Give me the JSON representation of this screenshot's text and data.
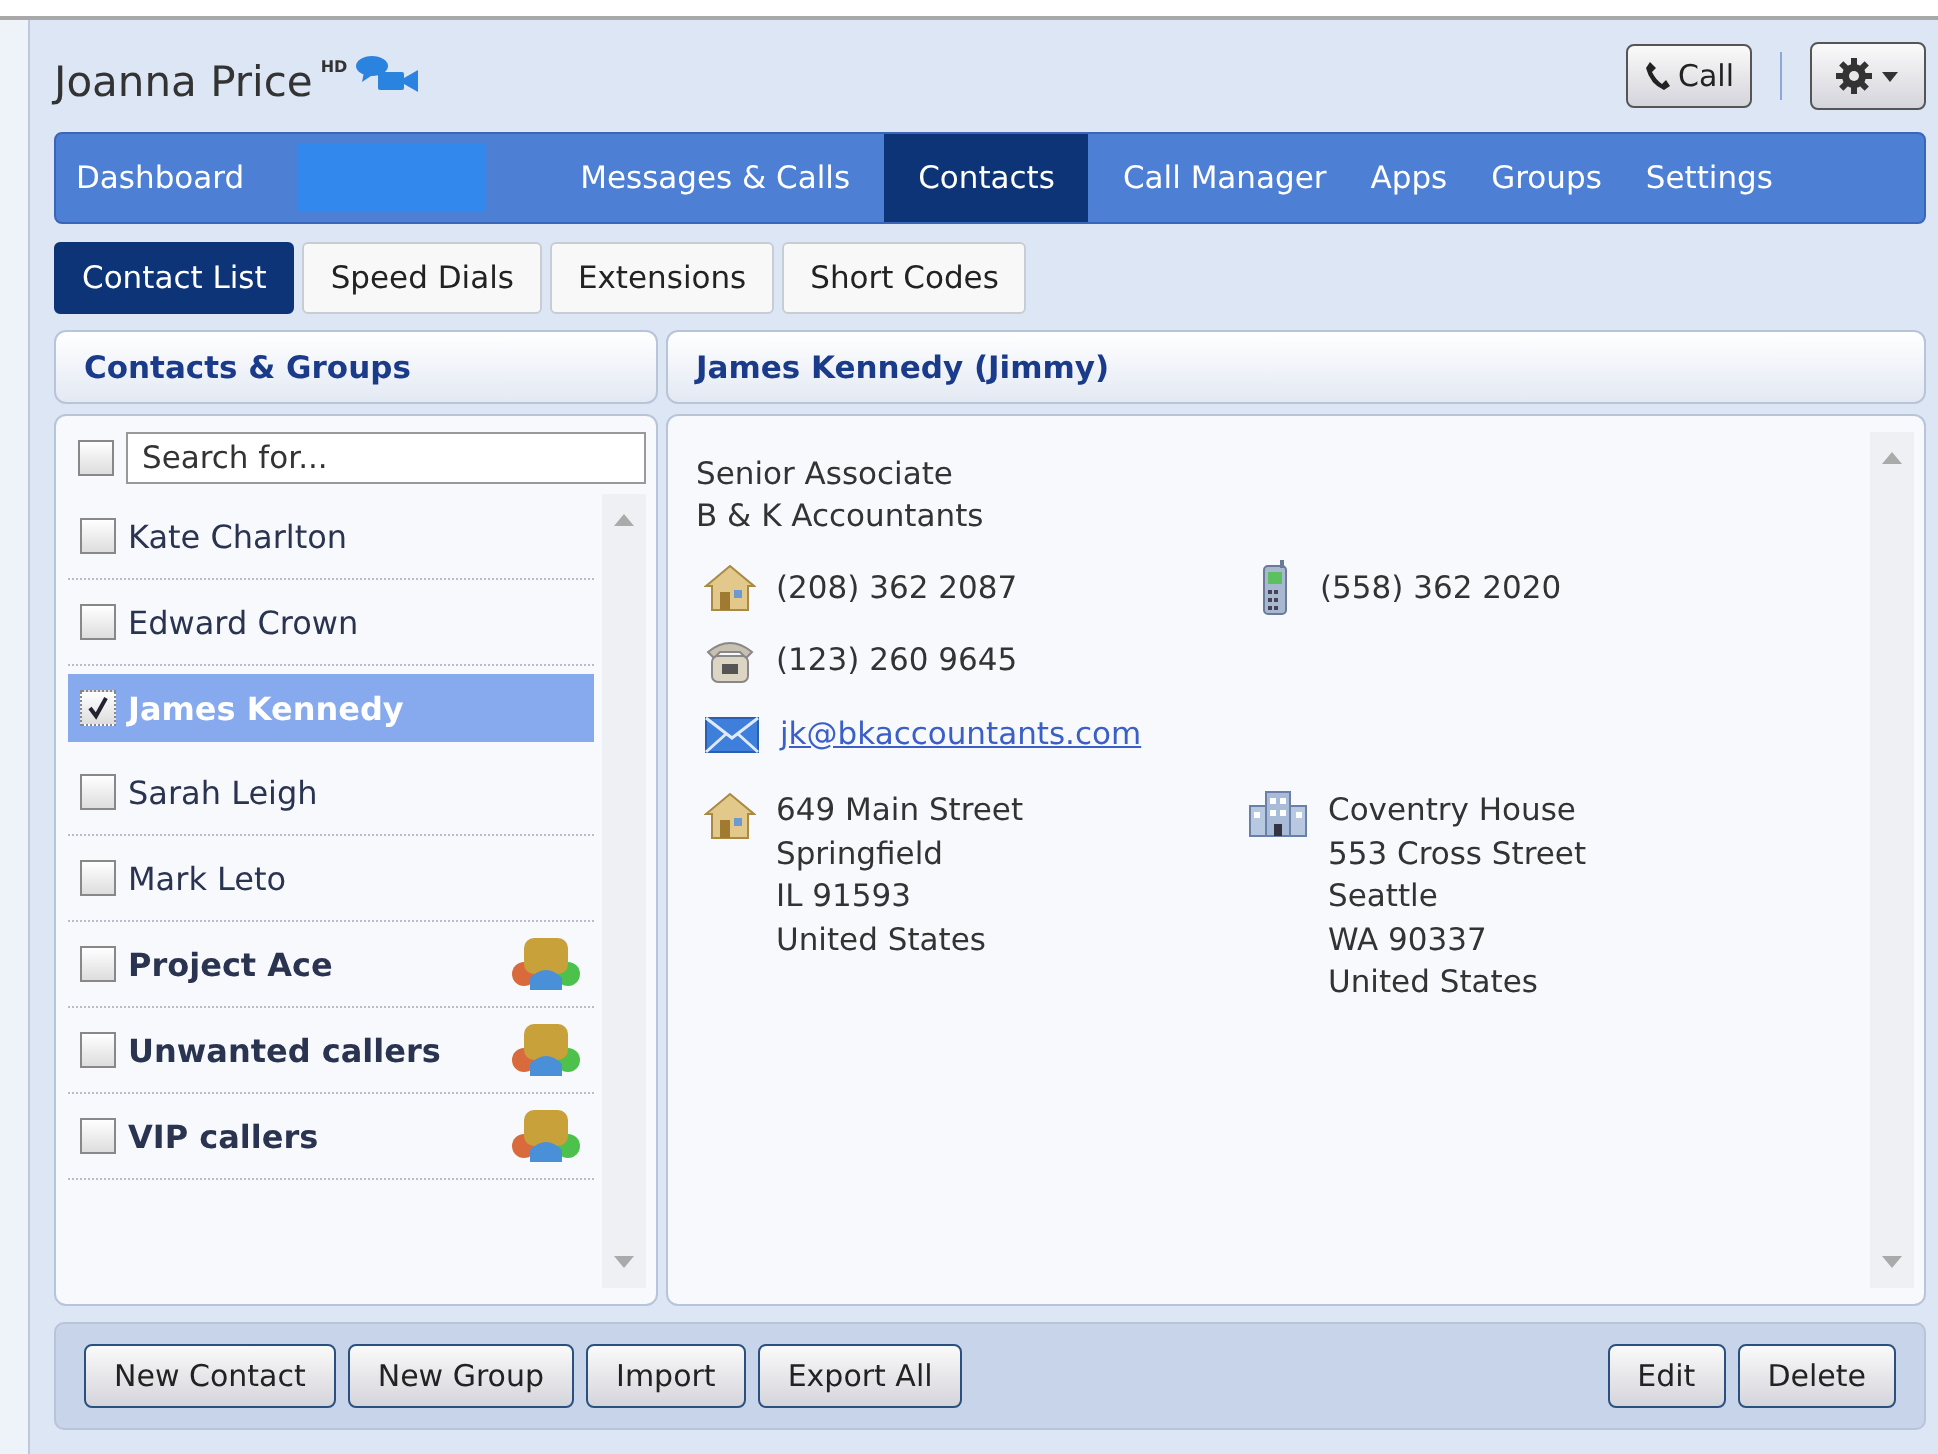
{
  "header": {
    "user_name": "Joanna Price",
    "hd_badge": "HD",
    "call_button": "Call"
  },
  "nav": [
    {
      "label": "Dashboard",
      "kind": "tab",
      "selected": false
    },
    {
      "kind": "redacted"
    },
    {
      "label": "Messages & Calls",
      "kind": "tab",
      "selected": false
    },
    {
      "label": "Contacts",
      "kind": "tab",
      "selected": true
    },
    {
      "label": "Call Manager",
      "kind": "tab",
      "selected": false
    },
    {
      "label": "Apps",
      "kind": "tab",
      "selected": false
    },
    {
      "label": "Groups",
      "kind": "tab",
      "selected": false
    },
    {
      "label": "Settings",
      "kind": "tab",
      "selected": false
    }
  ],
  "subtabs": [
    {
      "label": "Contact List",
      "selected": true
    },
    {
      "label": "Speed Dials",
      "selected": false
    },
    {
      "label": "Extensions",
      "selected": false
    },
    {
      "label": "Short Codes",
      "selected": false
    }
  ],
  "contacts_panel": {
    "title": "Contacts & Groups",
    "select_all_checked": false,
    "search": {
      "placeholder": "Search for..."
    },
    "items": [
      {
        "name": "Kate Charlton",
        "kind": "contact",
        "checked": false,
        "selected": false
      },
      {
        "name": "Edward Crown",
        "kind": "contact",
        "checked": false,
        "selected": false
      },
      {
        "name": "James Kennedy",
        "kind": "contact",
        "checked": true,
        "selected": true
      },
      {
        "name": "Sarah Leigh",
        "kind": "contact",
        "checked": false,
        "selected": false
      },
      {
        "name": "Mark Leto",
        "kind": "contact",
        "checked": false,
        "selected": false
      },
      {
        "name": "Project Ace",
        "kind": "group",
        "checked": false,
        "selected": false
      },
      {
        "name": "Unwanted callers",
        "kind": "group",
        "checked": false,
        "selected": false
      },
      {
        "name": "VIP callers",
        "kind": "group",
        "checked": false,
        "selected": false
      }
    ]
  },
  "detail": {
    "title": "James Kennedy (Jimmy)",
    "job_title": "Senior Associate",
    "company": "B & K Accountants",
    "phones": [
      {
        "kind": "home",
        "number": "(208) 362 2087"
      },
      {
        "kind": "mobile",
        "number": "(558) 362 2020"
      },
      {
        "kind": "landline",
        "number": "(123) 260 9645"
      }
    ],
    "email": "jk@bkaccountants.com",
    "addresses": [
      {
        "kind": "home",
        "lines": [
          "649 Main Street",
          "Springfield",
          "IL 91593",
          "United States"
        ]
      },
      {
        "kind": "work",
        "lines": [
          "Coventry House",
          "553 Cross Street",
          "Seattle",
          "WA 90337",
          "United States"
        ]
      }
    ]
  },
  "footer": {
    "left_buttons": [
      "New Contact",
      "New Group",
      "Import",
      "Export All"
    ],
    "right_buttons": [
      "Edit",
      "Delete"
    ]
  }
}
